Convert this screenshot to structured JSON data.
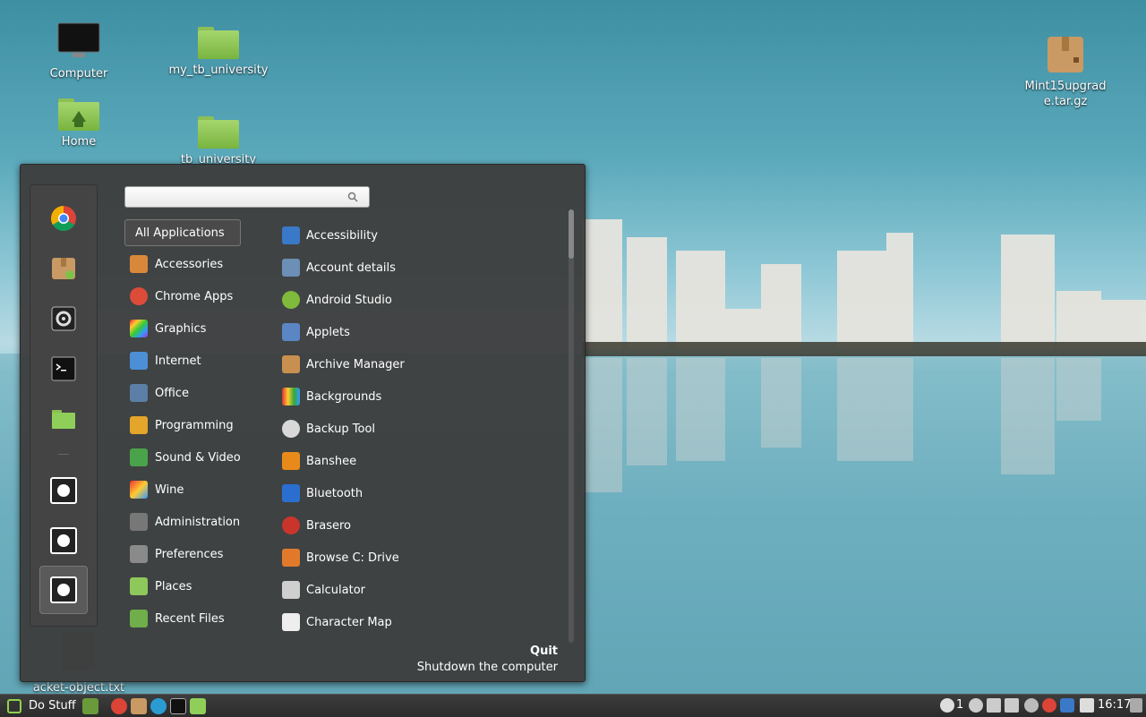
{
  "desktop": {
    "icons": [
      {
        "label": "Computer"
      },
      {
        "label": "my_tb_university"
      },
      {
        "label": "Home"
      },
      {
        "label": "tb_university"
      },
      {
        "label": "Mint15upgrade.tar.gz"
      },
      {
        "label": "acket-object.txt"
      }
    ]
  },
  "menu": {
    "search": {
      "value": "",
      "placeholder": ""
    },
    "favorites": [
      {
        "icon": "chrome-icon"
      },
      {
        "icon": "package-icon"
      },
      {
        "icon": "settings-icon"
      },
      {
        "icon": "terminal-icon"
      },
      {
        "icon": "folder-icon"
      }
    ],
    "session": [
      {
        "icon": "lock-screen-icon"
      },
      {
        "icon": "logout-icon"
      },
      {
        "icon": "shutdown-icon"
      }
    ],
    "categories": [
      {
        "label": "All Applications",
        "color": "#4a4a4a"
      },
      {
        "label": "Accessories",
        "color": "#d9883a"
      },
      {
        "label": "Chrome Apps",
        "color": "#dd4b39"
      },
      {
        "label": "Graphics",
        "color": "#a855c7"
      },
      {
        "label": "Internet",
        "color": "#4c8fd6"
      },
      {
        "label": "Office",
        "color": "#5b7fa6"
      },
      {
        "label": "Programming",
        "color": "#e3a52a"
      },
      {
        "label": "Sound & Video",
        "color": "#4aa34a"
      },
      {
        "label": "Wine",
        "color": "#c74a4a"
      },
      {
        "label": "Administration",
        "color": "#777777"
      },
      {
        "label": "Preferences",
        "color": "#8a8a8a"
      },
      {
        "label": "Places",
        "color": "#8fc85a"
      },
      {
        "label": "Recent Files",
        "color": "#6fae4a"
      }
    ],
    "apps": [
      {
        "label": "Accessibility",
        "color": "#3a78c8"
      },
      {
        "label": "Account details",
        "color": "#6c8fb5"
      },
      {
        "label": "Android Studio",
        "color": "#7fba3c"
      },
      {
        "label": "Applets",
        "color": "#5a86c4"
      },
      {
        "label": "Archive Manager",
        "color": "#c8904f"
      },
      {
        "label": "Backgrounds",
        "color": "#d9a13a"
      },
      {
        "label": "Backup Tool",
        "color": "#d8d8d8"
      },
      {
        "label": "Banshee",
        "color": "#e88a1a"
      },
      {
        "label": "Bluetooth",
        "color": "#2a6fd0"
      },
      {
        "label": "Brasero",
        "color": "#c9352b"
      },
      {
        "label": "Browse C: Drive",
        "color": "#e07a2a"
      },
      {
        "label": "Calculator",
        "color": "#cfcfcf"
      },
      {
        "label": "Character Map",
        "color": "#eeeeee"
      }
    ],
    "quit": {
      "title": "Quit",
      "description": "Shutdown the computer"
    }
  },
  "panel": {
    "menu_label": "Do Stuff",
    "launchers": [
      "show-desktop-icon",
      "chrome-icon",
      "package-icon",
      "app-icon",
      "terminal-icon",
      "folder-icon"
    ],
    "notification_count": "1",
    "clock": "16:17"
  }
}
